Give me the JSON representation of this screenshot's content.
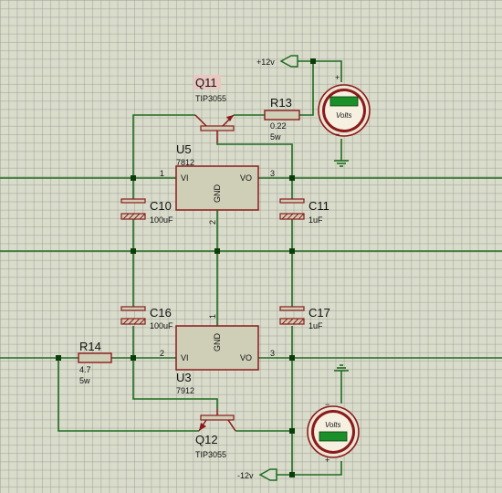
{
  "components": {
    "q11": {
      "ref": "Q11",
      "part": "TIP3055"
    },
    "q12": {
      "ref": "Q12",
      "part": "TIP3055"
    },
    "r13": {
      "ref": "R13",
      "value": "0.22",
      "power": "5w"
    },
    "r14": {
      "ref": "R14",
      "value": "4.7",
      "power": "5w"
    },
    "u5": {
      "ref": "U5",
      "part": "7812",
      "pin_vi": "VI",
      "pin_vo": "VO",
      "pin_gnd": "GND",
      "pin1": "1",
      "pin2": "2",
      "pin3": "3"
    },
    "u3": {
      "ref": "U3",
      "part": "7912",
      "pin_vi": "VI",
      "pin_vo": "VO",
      "pin_gnd": "GND",
      "pin1": "1",
      "pin2": "2",
      "pin3": "3"
    },
    "c10": {
      "ref": "C10",
      "value": "100uF"
    },
    "c11": {
      "ref": "C11",
      "value": "1uF"
    },
    "c16": {
      "ref": "C16",
      "value": "100uF"
    },
    "c17": {
      "ref": "C17",
      "value": "1uF"
    }
  },
  "terminals": {
    "pos": "+12v",
    "neg": "-12v"
  },
  "voltmeters": {
    "top": {
      "label": "Volts",
      "plus": "+",
      "minus": "−"
    },
    "bottom": {
      "label": "Volts",
      "plus": "+",
      "minus": "−"
    }
  },
  "colors": {
    "wire": "#1f6b1f",
    "component": "#8b1a1a",
    "body": "#cfcfb8",
    "meter_face": "#f5f0e0",
    "meter_display": "#1a8f2a",
    "node": "#0b3d0b"
  }
}
